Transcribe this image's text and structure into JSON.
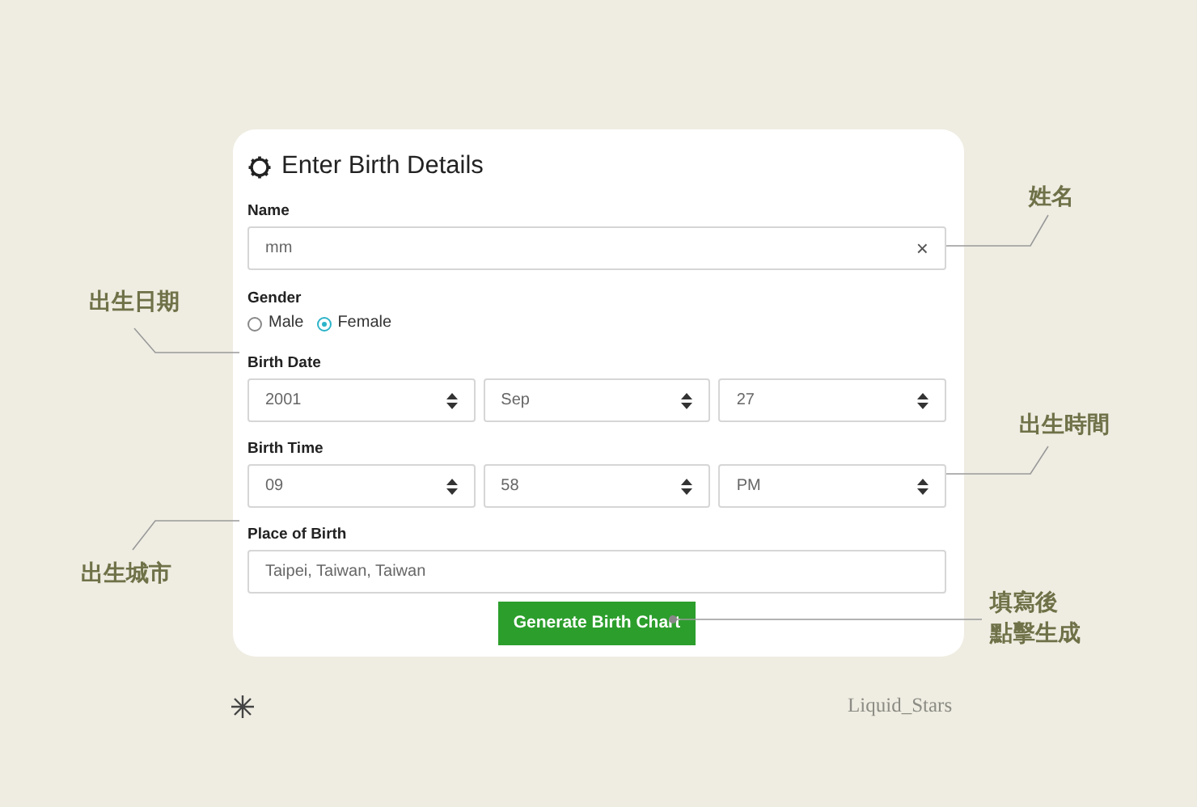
{
  "form": {
    "title": "Enter Birth Details",
    "name_field": {
      "label": "Name",
      "value": "mm",
      "clear": "×"
    },
    "gender": {
      "label": "Gender",
      "options": [
        {
          "label": "Male",
          "selected": false
        },
        {
          "label": "Female",
          "selected": true
        }
      ]
    },
    "birth_date": {
      "label": "Birth Date",
      "selects": [
        "2001",
        "Sep",
        "27"
      ]
    },
    "birth_time": {
      "label": "Birth Time",
      "selects": [
        "09",
        "58",
        "PM"
      ]
    },
    "place": {
      "label": "Place of Birth",
      "value": "Taipei, Taiwan, Taiwan"
    },
    "submit": "Generate Birth Chart"
  },
  "annotations": [
    {
      "lines": [
        "姓名"
      ]
    },
    {
      "lines": [
        "出生日期"
      ]
    },
    {
      "lines": [
        "出生時間"
      ]
    },
    {
      "lines": [
        "出生城市"
      ]
    },
    {
      "lines": [
        "填寫後",
        "點擊生成"
      ]
    }
  ],
  "signature": "Liquid_Stars"
}
